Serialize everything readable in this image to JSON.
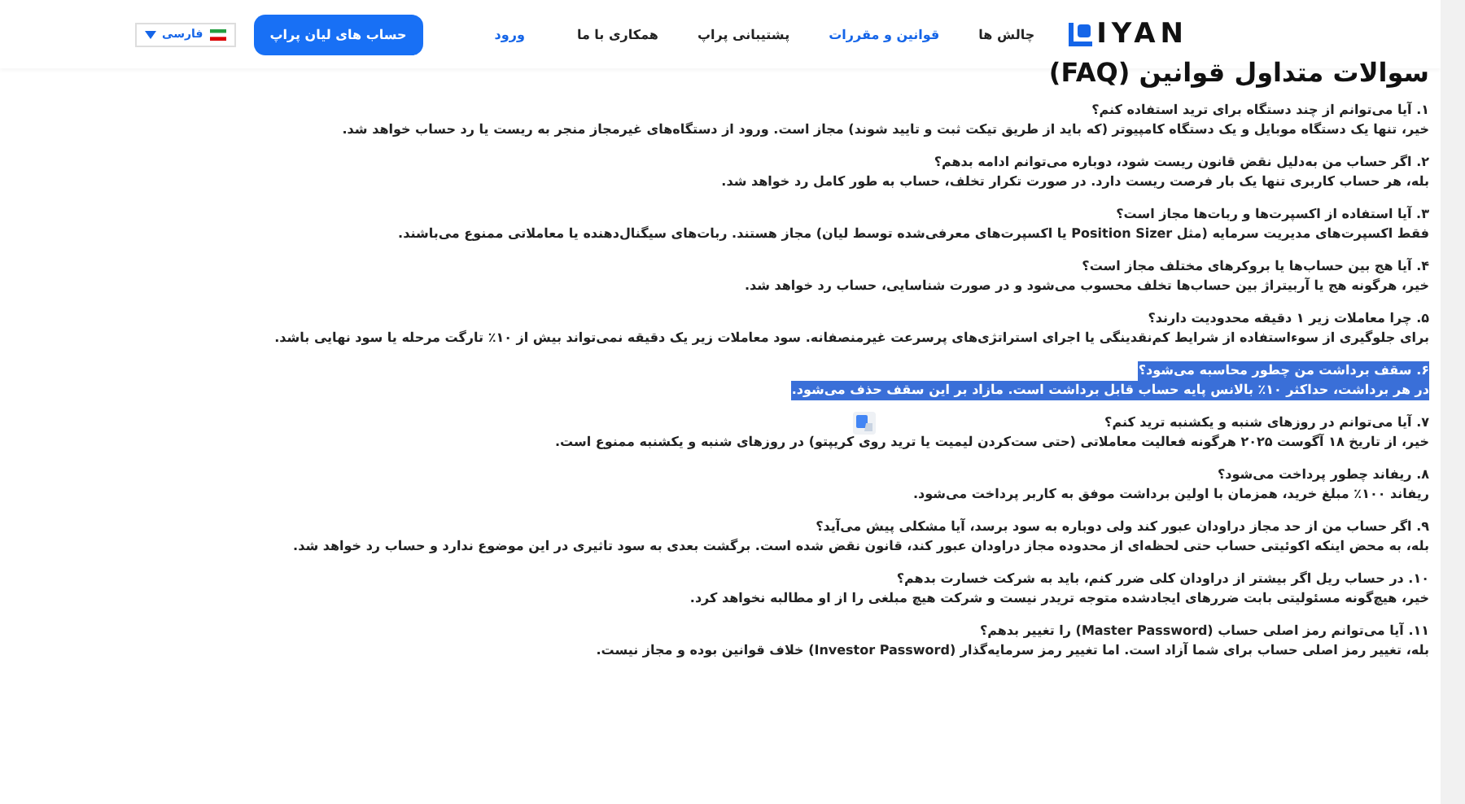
{
  "header": {
    "logo": "IYAN",
    "nav": [
      {
        "label": "چالش ها",
        "selected": false
      },
      {
        "label": "قوانین و مقررات",
        "selected": true
      },
      {
        "label": "پشتیبانی پراپ",
        "selected": false
      },
      {
        "label": "همکاری با ما",
        "selected": false
      }
    ],
    "login": "ورود",
    "cta": "حساب های لیان پراپ",
    "language": "فارسی"
  },
  "title": "سوالات متداول قوانین (FAQ)",
  "faq": [
    {
      "question": "۱. آیا می‌توانم از چند دستگاه برای ترید استفاده کنم؟",
      "answer": "خیر، تنها یک دستگاه موبایل و یک دستگاه کامپیوتر (که باید از طریق تیکت ثبت و تایید شوند) مجاز است. ورود از دستگاه‌های غیرمجاز منجر به ریست یا رد حساب خواهد شد.",
      "highlighted": false
    },
    {
      "question": "۲. اگر حساب من به‌دلیل نقض قانون ریست شود، دوباره می‌توانم ادامه بدهم؟",
      "answer": "بله، هر حساب کاربری تنها یک بار فرصت ریست دارد. در صورت تکرار تخلف، حساب به طور کامل رد خواهد شد.",
      "highlighted": false
    },
    {
      "question": "۳. آیا استفاده از اکسپرت‌ها و ربات‌ها مجاز است؟",
      "answer": "فقط اکسپرت‌های مدیریت سرمایه (مثل Position Sizer یا اکسپرت‌های معرفی‌شده توسط لیان) مجاز هستند. ربات‌های سیگنال‌دهنده یا معاملاتی ممنوع می‌باشند.",
      "highlighted": false
    },
    {
      "question": "۴. آیا هج بین حساب‌ها یا بروکرهای مختلف مجاز است؟",
      "answer": "خیر، هرگونه هج یا آربیتراژ بین حساب‌ها تخلف محسوب می‌شود و در صورت شناسایی، حساب رد خواهد شد.",
      "highlighted": false
    },
    {
      "question": "۵. چرا معاملات زیر ۱ دقیقه محدودیت دارند؟",
      "answer": "برای جلوگیری از سوءاستفاده از شرایط کم‌نقدینگی یا اجرای استراتژی‌های پرسرعت غیرمنصفانه. سود معاملات زیر یک دقیقه نمی‌تواند بیش از ۱۰٪ تارگت مرحله یا سود نهایی باشد.",
      "highlighted": false
    },
    {
      "question": "۶. سقف برداشت من چطور محاسبه می‌شود؟",
      "answer": "در هر برداشت، حداکثر ۱۰٪ بالانس پایه حساب قابل برداشت است. مازاد بر این سقف حذف می‌شود.",
      "highlighted": true
    },
    {
      "question": "۷. آیا می‌توانم در روزهای شنبه و یکشنبه ترید کنم؟",
      "answer": "خیر، از تاریخ ۱۸ آگوست ۲۰۲۵ هرگونه فعالیت معاملاتی (حتی ست‌کردن لیمیت یا ترید روی کریپتو) در روزهای شنبه و یکشنبه ممنوع است.",
      "highlighted": false
    },
    {
      "question": "۸. ریفاند چطور پرداخت می‌شود؟",
      "answer": "ریفاند ۱۰۰٪ مبلغ خرید، همزمان با اولین برداشت موفق به کاربر پرداخت می‌شود.",
      "highlighted": false
    },
    {
      "question": "۹. اگر حساب من از حد مجاز دراودان عبور کند ولی دوباره به سود برسد، آیا مشکلی پیش می‌آید؟",
      "answer": "بله، به محض اینکه اکوئیتی حساب حتی لحظه‌ای از محدوده مجاز دراودان عبور کند، قانون نقض شده است. برگشت بعدی به سود تاثیری در این موضوع ندارد و حساب رد خواهد شد.",
      "highlighted": false
    },
    {
      "question": "۱۰. در حساب ریل اگر بیشتر از دراودان کلی ضرر کنم، باید به شرکت خسارت بدهم؟",
      "answer": "خیر، هیچ‌گونه مسئولیتی بابت ضررهای ایجادشده متوجه تریدر نیست و شرکت هیچ مبلغی را از او مطالبه نخواهد کرد.",
      "highlighted": false
    },
    {
      "question": "۱۱. آیا می‌توانم رمز اصلی حساب (Master Password) را تغییر بدهم؟",
      "answer": "بله، تغییر رمز اصلی حساب برای شما آزاد است. اما تغییر رمز سرمایه‌گذار (Investor Password) خلاف قوانین بوده و مجاز نیست.",
      "highlighted": false
    }
  ]
}
